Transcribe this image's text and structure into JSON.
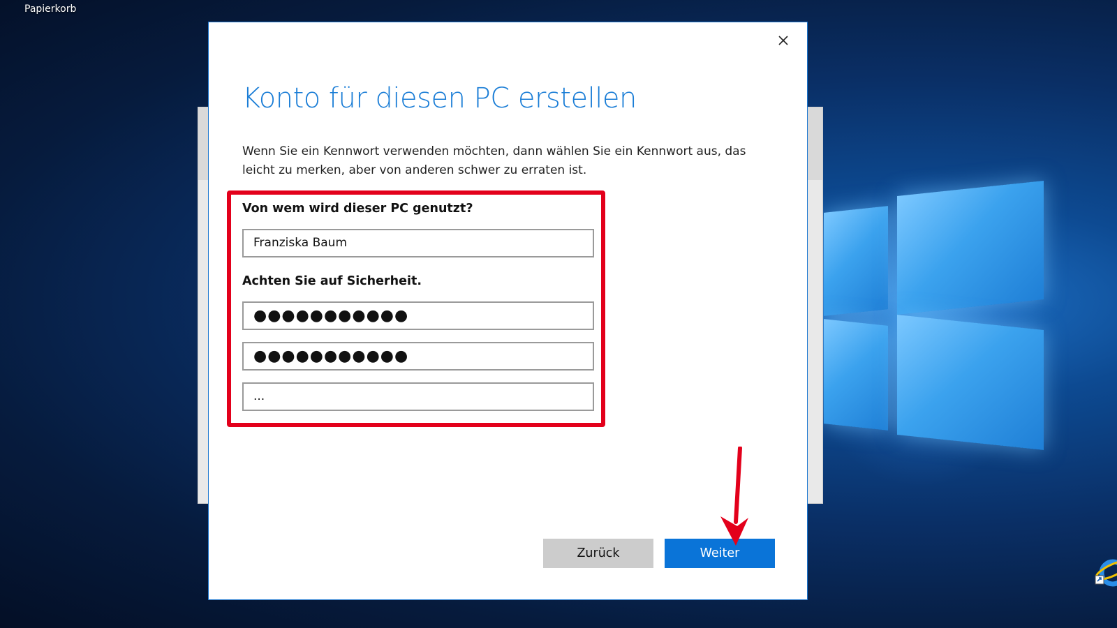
{
  "desktop": {
    "recycle_bin_label": "Papierkorb"
  },
  "dialog": {
    "title": "Konto für diesen PC erstellen",
    "description": "Wenn Sie ein Kennwort verwenden möchten, dann wählen Sie ein Kennwort aus, das leicht zu merken, aber von anderen schwer zu erraten ist.",
    "user_question": "Von wem wird dieser PC genutzt?",
    "username_value": "Franziska Baum",
    "security_heading": "Achten Sie auf Sicherheit.",
    "password_value": "●●●●●●●●●●●",
    "password_confirm_value": "●●●●●●●●●●●",
    "hint_value": "...",
    "back_label": "Zurück",
    "next_label": "Weiter"
  },
  "colors": {
    "accent": "#0a74d8",
    "title": "#1a7dd6",
    "highlight": "#e3001b"
  }
}
